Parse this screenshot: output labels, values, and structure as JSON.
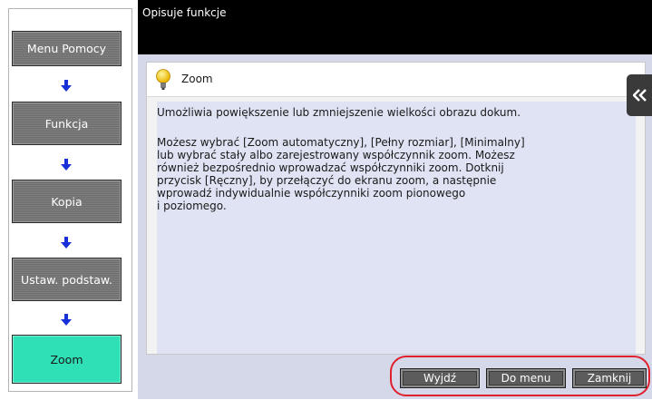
{
  "header": {
    "title": "Opisuje funkcje"
  },
  "nav": {
    "items": [
      {
        "label": "Menu Pomocy"
      },
      {
        "label": "Funkcja"
      },
      {
        "label": "Kopia"
      },
      {
        "label": "Ustaw. podstaw."
      },
      {
        "label": "Zoom"
      }
    ],
    "active_index": 4,
    "arrow_icon": "arrow-down-icon"
  },
  "content": {
    "icon": "lightbulb-icon",
    "title": "Zoom",
    "paragraph1": "Umożliwia powiększenie lub zmniejszenie wielkości obrazu dokum.",
    "paragraph2": "Możesz wybrać [Zoom automatyczny], [Pełny rozmiar], [Minimalny]\nlub wybrać stały albo zarejestrowany współczynnik zoom. Możesz\nrównież bezpośrednio wprowadzać współczynniki zoom. Dotknij\nprzycisk [Ręczny], by przełączyć do ekranu zoom, a następnie\nwprowadź indywidualnie współczynniki zoom pionowego\ni poziomego."
  },
  "side_tab": {
    "icon": "double-chevron-left-icon"
  },
  "buttons": {
    "exit": "Wyjdź",
    "to_menu": "Do menu",
    "close": "Zamknij"
  },
  "colors": {
    "active_nav": "#2fe0b6",
    "arrow": "#1830d8",
    "highlight_outline": "#e0202c",
    "header": "#000000"
  }
}
